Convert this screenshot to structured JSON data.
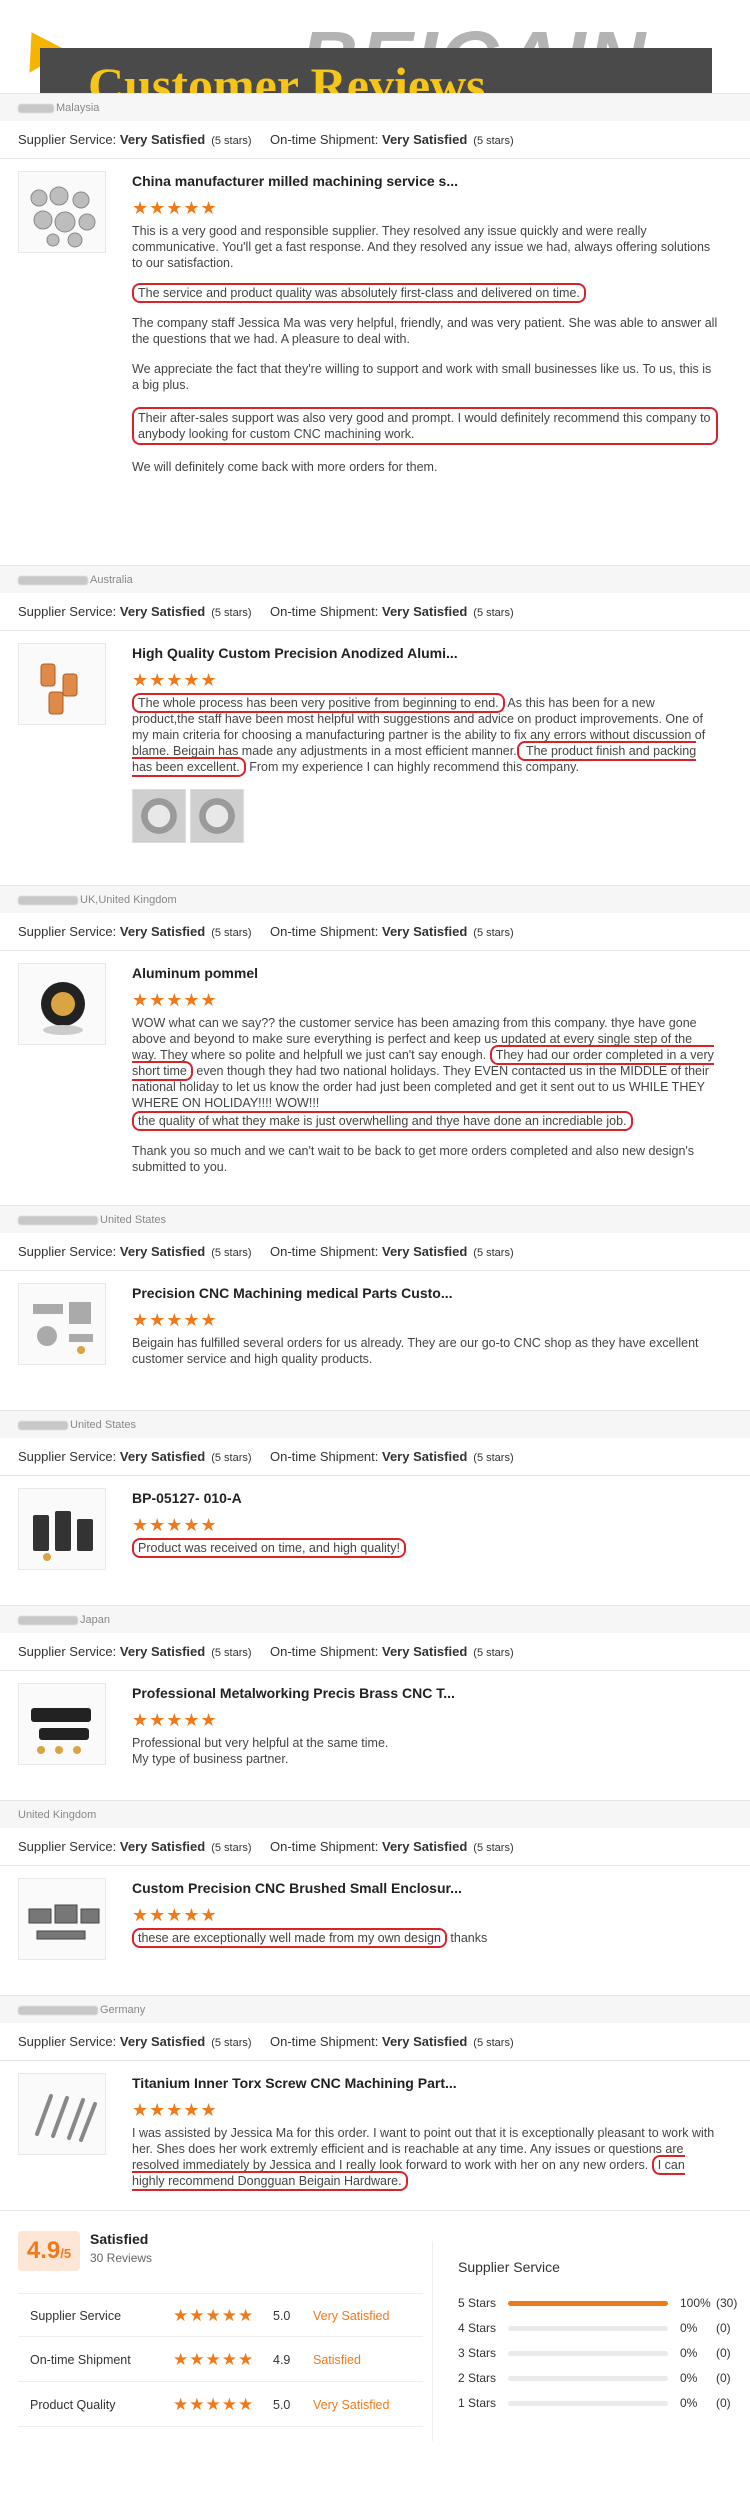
{
  "banner": {
    "title": "Customer Reviews",
    "brand": "BEIGAIN"
  },
  "labels": {
    "supplier_service": "Supplier Service:",
    "on_time_shipment": "On-time Shipment:",
    "very_satisfied": "Very Satisfied",
    "five_stars": "(5 stars)",
    "stars_glyph": "★★★★★"
  },
  "reviews": [
    {
      "country": "Malaysia",
      "title": "China manufacturer milled machining service s...",
      "paragraphs": [
        "This is a very good and responsible supplier. They resolved any issue quickly and were really communicative. You'll get a fast response. And they resolved any issue we had, always offering solutions to our satisfaction.",
        "The service and product quality was absolutely first-class and delivered on time.",
        "The company staff Jessica Ma was very helpful, friendly, and was very patient. She was able to answer all the questions that we had. A pleasure to deal with.",
        "We appreciate the fact that they're willing to support and work with small businesses like us. To us, this is a big plus.",
        "Their after-sales support was also very good and prompt. I would definitely recommend this company to anybody looking for custom CNC machining work.",
        "We will definitely come back with more orders for them."
      ]
    },
    {
      "country": "Australia",
      "title": "High Quality Custom Precision Anodized Alumi...",
      "highlight_a": "The whole process has been very positive from beginning to end.",
      "text_a": " As this has been for a new product,the staff have been most helpful with suggestions and advice on product improvements.  One of my main criteria for choosing a manufacturing partner is the ability to fix any errors without discussion of blame. Beigain has made any adjustments in a most efficient manner.",
      "highlight_b": " The product finish and packing has been excellent.",
      "text_b": " From my experience I can highly recommend this company."
    },
    {
      "country": "UK,United Kingdom",
      "title": "Aluminum pommel",
      "text_a": "WOW what can we say?? the customer service has been amazing from this company. thye have gone above and beyond to make sure everything is perfect and keep us updated at every single step of the way. They where so polite and helpfull we just can't say enough.",
      "highlight_a": "They had our order completed in a very short time",
      "text_b": " even though they had two national holidays. They EVEN contacted us in the MIDDLE of their national holiday to let us know the order had just been completed and get it sent out to us WHILE THEY WHERE ON HOLIDAY!!!! WOW!!!",
      "highlight_b": "the quality of what they make is just overwhelling and thye have done an incrediable job.",
      "text_c": "Thank you so much and we can't wait to be back to get more orders completed and also new design's submitted to you."
    },
    {
      "country": "United States",
      "title": "Precision CNC Machining medical Parts Custo...",
      "text_a": "Beigain has fulfilled several orders for us already. They are our go-to CNC shop as they have excellent customer service and high quality products."
    },
    {
      "country": "United States",
      "title": "BP-05127- 010-A",
      "highlight_a": "Product was received on time, and high quality!"
    },
    {
      "country": "Japan",
      "title": "Professional Metalworking Precis Brass CNC T...",
      "text_a": "Professional but very helpful at the same time.",
      "text_b": "My type of business partner."
    },
    {
      "country": "United Kingdom",
      "title": "Custom Precision CNC Brushed Small Enclosur...",
      "highlight_a": "these are exceptionally well made from my own design",
      "text_a": " thanks"
    },
    {
      "country": "Germany",
      "title": "Titanium Inner Torx Screw CNC Machining Part...",
      "text_a": "I was assisted by Jessica Ma for this order. I want to point out that it is exceptionally pleasant to work with her. Shes does her work extremly efficient and is reachable at any time. Any issues or questions are resolved immediately by Jessica and I really look forward to work with her on any new orders.",
      "highlight_a": "I can highly recommend Dongguan Beigain Hardware."
    }
  ],
  "summary": {
    "score": "4.9",
    "score_suffix": "/5",
    "satisfied": "Satisfied",
    "reviews_count": "30 Reviews",
    "categories": [
      {
        "label": "Supplier Service",
        "score": "5.0",
        "word": "Very Satisfied"
      },
      {
        "label": "On-time Shipment",
        "score": "4.9",
        "word": "Satisfied"
      },
      {
        "label": "Product Quality",
        "score": "5.0",
        "word": "Very Satisfied"
      }
    ],
    "distribution_title": "Supplier Service",
    "distribution": [
      {
        "label": "5 Stars",
        "pct": "100%",
        "fraction": 1.0,
        "count": "(30)"
      },
      {
        "label": "4 Stars",
        "pct": "0%",
        "fraction": 0,
        "count": "(0)"
      },
      {
        "label": "3 Stars",
        "pct": "0%",
        "fraction": 0,
        "count": "(0)"
      },
      {
        "label": "2 Stars",
        "pct": "0%",
        "fraction": 0,
        "count": "(0)"
      },
      {
        "label": "1 Stars",
        "pct": "0%",
        "fraction": 0,
        "count": "(0)"
      }
    ],
    "colors": {
      "accent": "#f07a1a",
      "highlight_border": "#d8232a",
      "banner_title": "#f5c518"
    }
  }
}
